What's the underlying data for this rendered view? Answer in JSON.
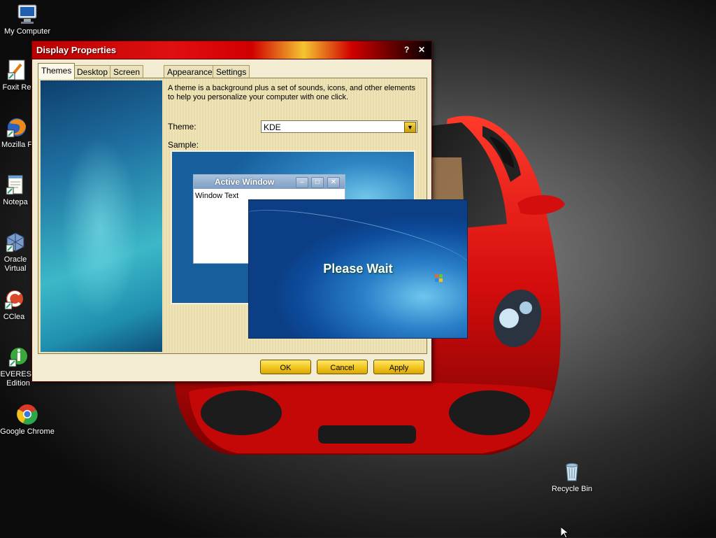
{
  "desktop": {
    "icons": [
      {
        "label": "My Computer",
        "icon": "computer-icon"
      },
      {
        "label": "Foxit Re",
        "icon": "foxit-reader-icon"
      },
      {
        "label": "Mozilla F",
        "icon": "firefox-icon"
      },
      {
        "label": "Notepa",
        "icon": "notepad-icon"
      },
      {
        "label": "Oracle",
        "label2": "Virtual",
        "icon": "virtualbox-icon"
      },
      {
        "label": "CClea",
        "icon": "ccleaner-icon"
      },
      {
        "label": "EVEREST",
        "label2": "Edition",
        "icon": "everest-icon"
      },
      {
        "label": "Google Chrome",
        "icon": "chrome-icon"
      },
      {
        "label": "Recycle Bin",
        "icon": "recycle-bin-icon"
      }
    ]
  },
  "window": {
    "title": "Display Properties",
    "help_btn": "?",
    "close_btn": "✕",
    "tabs": [
      "Themes",
      "Desktop",
      "Screen Saver",
      "Appearance",
      "Settings"
    ],
    "active_tab": "Themes",
    "description": "A theme is a background plus a set of sounds, icons, and other elements to help you personalize your computer with one click.",
    "theme_label": "Theme:",
    "theme_value": "KDE",
    "sample_label": "Sample:",
    "sample_window": {
      "title": "Active Window",
      "text": "Window Text",
      "min": "–",
      "max": "□",
      "close": "✕"
    },
    "buttons": {
      "ok": "OK",
      "cancel": "Cancel",
      "apply": "Apply"
    }
  },
  "overlay": {
    "message": "Please Wait"
  },
  "colors": {
    "titlebar_red": "#d00000",
    "button_yellow": "#f2c51e",
    "car_red": "#d40d0d"
  }
}
